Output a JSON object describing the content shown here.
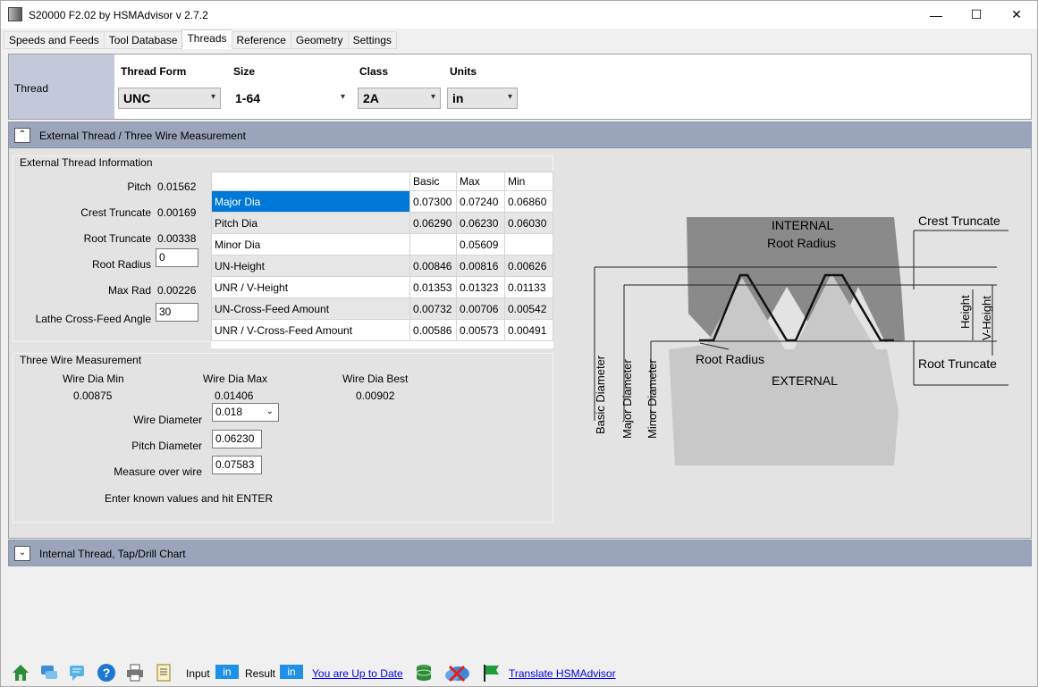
{
  "window": {
    "title": "S20000 F2.02 by HSMAdvisor v 2.7.2",
    "minimize": "—",
    "maximize": "☐",
    "close": "✕"
  },
  "tabs": [
    "Speeds and Feeds",
    "Tool Database",
    "Threads",
    "Reference",
    "Geometry",
    "Settings"
  ],
  "thread_panel": {
    "label": "Thread",
    "form_label": "Thread Form",
    "form_value": "UNC",
    "size_label": "Size",
    "size_value": "1-64",
    "class_label": "Class",
    "class_value": "2A",
    "units_label": "Units",
    "units_value": "in"
  },
  "external_section": {
    "title": "External Thread / Three Wire Measurement",
    "toggle": "⌃"
  },
  "ext_info": {
    "title": "External Thread Information",
    "pitch_label": "Pitch",
    "pitch": "0.01562",
    "crest_label": "Crest Truncate",
    "crest": "0.00169",
    "root_label": "Root Truncate",
    "root": "0.00338",
    "radius_label": "Root Radius",
    "radius": "0",
    "maxrad_label": "Max Rad",
    "maxrad": "0.00226",
    "angle_label": "Lathe Cross-Feed Angle",
    "angle": "30"
  },
  "table": {
    "headers": [
      "",
      "Basic",
      "Max",
      "Min"
    ],
    "rows": [
      {
        "name": "Major Dia",
        "basic": "0.07300",
        "max": "0.07240",
        "min": "0.06860"
      },
      {
        "name": "Pitch Dia",
        "basic": "0.06290",
        "max": "0.06230",
        "min": "0.06030"
      },
      {
        "name": "Minor Dia",
        "basic": "",
        "max": "0.05609",
        "min": ""
      },
      {
        "name": "UN-Height",
        "basic": "0.00846",
        "max": "0.00816",
        "min": "0.00626"
      },
      {
        "name": "UNR / V-Height",
        "basic": "0.01353",
        "max": "0.01323",
        "min": "0.01133"
      },
      {
        "name": "UN-Cross-Feed Amount",
        "basic": "0.00732",
        "max": "0.00706",
        "min": "0.00542"
      },
      {
        "name": "UNR / V-Cross-Feed Amount",
        "basic": "0.00586",
        "max": "0.00573",
        "min": "0.00491"
      }
    ]
  },
  "three_wire": {
    "title": "Three Wire Measurement",
    "min_label": "Wire Dia Min",
    "min": "0.00875",
    "max_label": "Wire Dia Max",
    "max": "0.01406",
    "best_label": "Wire Dia Best",
    "best": "0.00902",
    "wire_label": "Wire Diameter",
    "wire": "0.018",
    "pitch_label": "Pitch Diameter",
    "pitch": "0.06230",
    "measure_label": "Measure over wire",
    "measure": "0.07583",
    "hint": "Enter known values and hit ENTER"
  },
  "diagram": {
    "crest": "Crest Truncate",
    "internal": "INTERNAL",
    "root_radius_top": "Root Radius",
    "height": "Height",
    "vheight": "V-Height",
    "root_radius": "Root Radius",
    "root_truncate": "Root Truncate",
    "external": "EXTERNAL",
    "basic": "Basic Diameter",
    "major": "Major Diameter",
    "minor": "Minor Diameter"
  },
  "internal_section": {
    "title": "Internal Thread, Tap/Drill Chart",
    "toggle": "⌄"
  },
  "footer": {
    "input_label": "Input",
    "input_unit": "in",
    "result_label": "Result",
    "result_unit": "in",
    "update_link": "You are Up to Date",
    "translate_link": "Translate HSMAdvisor"
  }
}
